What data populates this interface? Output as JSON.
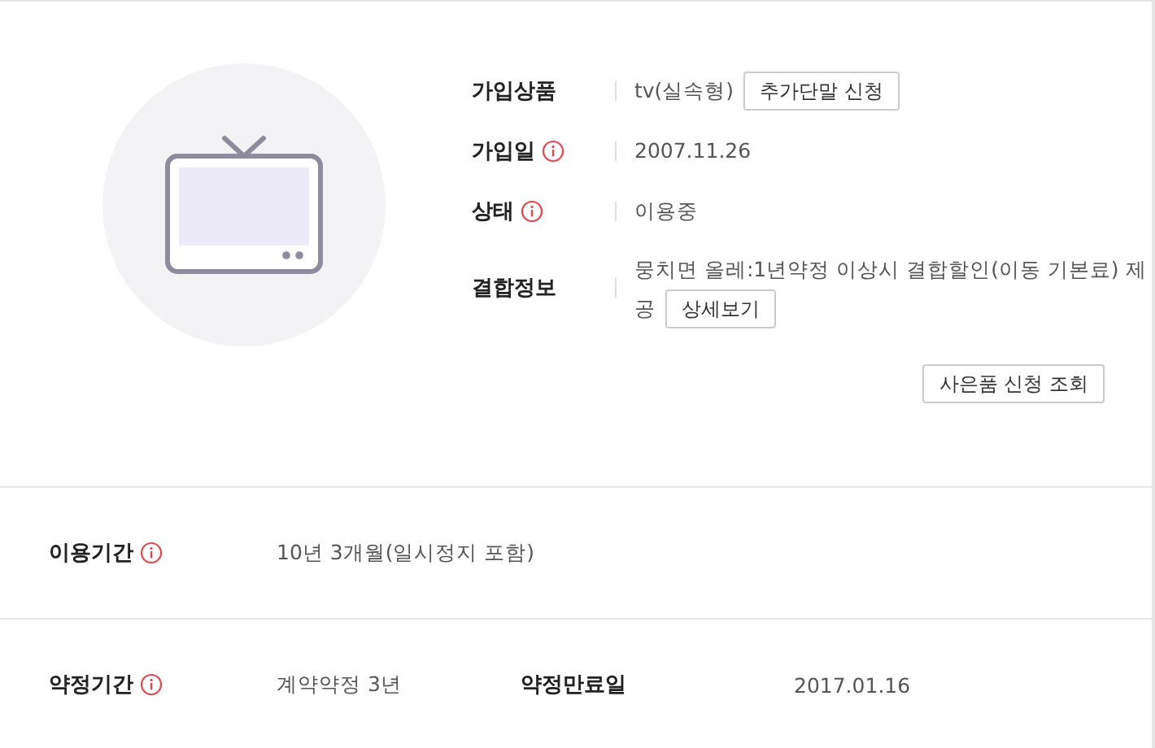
{
  "product_info": [
    {
      "label": "가입상품",
      "info": false,
      "value": "tv(실속형)",
      "button": "추가단말 신청"
    },
    {
      "label": "가입일",
      "info": true,
      "value": "2007.11.26"
    },
    {
      "label": "상태",
      "info": true,
      "value": "이용중"
    },
    {
      "label": "결합정보",
      "info": false,
      "value": "뭉치면 올레:1년약정 이상시 결합할인(이동 기본료) 제공",
      "button": "상세보기"
    }
  ],
  "gift_button": "사은품 신청 조회",
  "detail_rows": [
    {
      "cells": [
        {
          "label": "이용기간",
          "info": true,
          "value": "10년 3개월(일시정지 포함)"
        }
      ]
    },
    {
      "cells": [
        {
          "label": "약정기간",
          "info": true,
          "value": "계약약정 3년"
        },
        {
          "label": "약정만료일",
          "info": false,
          "value": "2017.01.16"
        }
      ]
    }
  ]
}
